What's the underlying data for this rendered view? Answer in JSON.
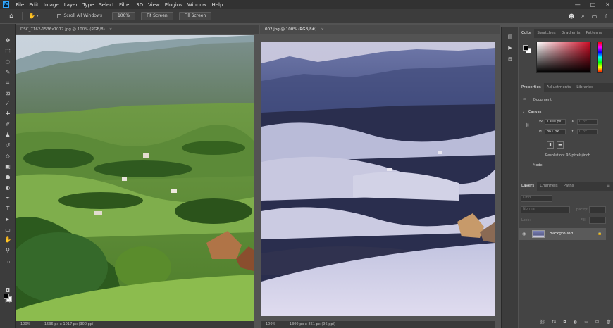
{
  "menu": {
    "logo": "Ps",
    "items": [
      "File",
      "Edit",
      "Image",
      "Layer",
      "Type",
      "Select",
      "Filter",
      "3D",
      "View",
      "Plugins",
      "Window",
      "Help"
    ],
    "window_controls": [
      "—",
      "□",
      "✕"
    ]
  },
  "options": {
    "scroll_all_label": "Scroll All Windows",
    "zoom_label": "100%",
    "fit_label": "Fit Screen",
    "fill_label": "Fill Screen"
  },
  "documents": [
    {
      "tab": "DSC_7162-1536x1017.jpg @ 100% (RGB/8)",
      "zoom": "100%",
      "info": "1536 px x 1017 px (300 ppi)"
    },
    {
      "tab": "002.jpg @ 100% (RGB/8#)",
      "zoom": "100%",
      "info": "1300 px x 861 px (96 ppi)"
    }
  ],
  "panels": {
    "color_tabs": [
      "Color",
      "Swatches",
      "Gradients",
      "Patterns"
    ],
    "properties_tabs": [
      "Properties",
      "Adjustments",
      "Libraries"
    ],
    "document_label": "Document",
    "canvas_label": "Canvas",
    "w_label": "W",
    "w_value": "1300 px",
    "h_label": "H",
    "h_value": "861 px",
    "x_label": "X",
    "x_value": "0 px",
    "y_label": "Y",
    "y_value": "0 px",
    "resolution": "Resolution: 96 pixels/inch",
    "mode_label": "Mode",
    "layers_tabs": [
      "Layers",
      "Channels",
      "Paths"
    ],
    "kind_placeholder": "Kind",
    "blend_mode": "Normal",
    "opacity_label": "Opacity:",
    "lock_label": "Lock:",
    "fill_label": "Fill:",
    "layer_name": "Background"
  },
  "colors": {
    "accent": "#31a8ff",
    "fg_swatch": "#000000",
    "bg_swatch": "#ffffff"
  }
}
